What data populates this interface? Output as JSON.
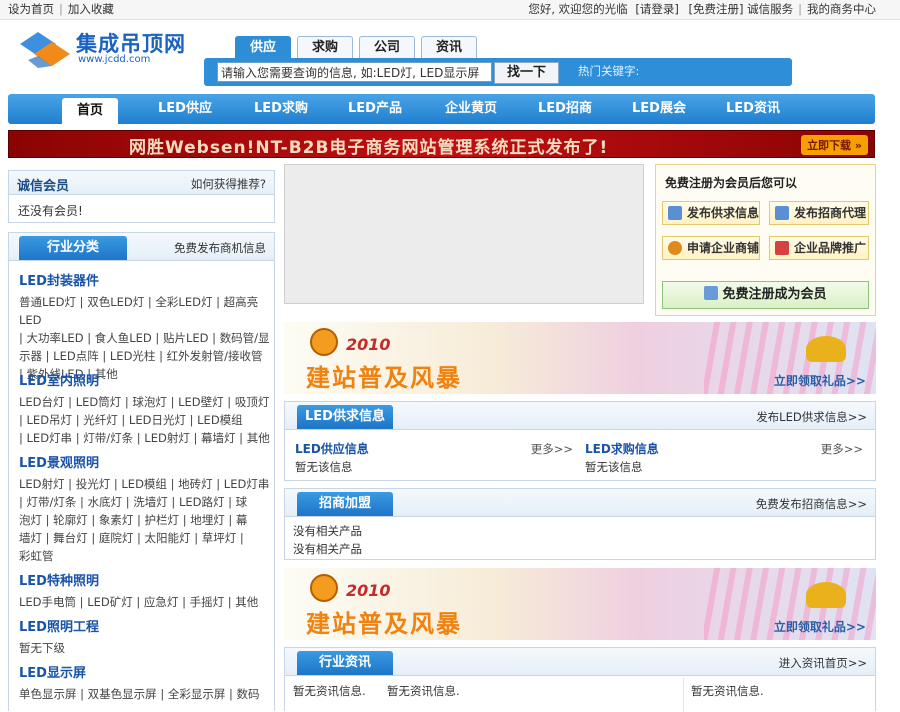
{
  "topbar": {
    "left": [
      "设为首页",
      "加入收藏"
    ],
    "welcome": "您好, 欢迎您的光临",
    "login": "[请登录]",
    "register": "[免费注册]",
    "service": "诚信服务",
    "center": "我的商务中心"
  },
  "logo": {
    "name": "集成吊顶网",
    "url": "www.jcdd.com"
  },
  "search": {
    "tabs": [
      "供应",
      "求购",
      "公司",
      "资讯"
    ],
    "placeholder": "请输入您需要查询的信息, 如:LED灯, LED显示屏",
    "button": "找一下",
    "hot_label": "热门关键字:"
  },
  "nav": [
    "首页",
    "LED供应",
    "LED求购",
    "LED产品",
    "企业黄页",
    "LED招商",
    "LED展会",
    "LED资讯"
  ],
  "banner": {
    "text": "网胜Websen!NT-B2B电子商务网站管理系统正式发布了!",
    "download": "立即下载 »"
  },
  "members": {
    "title": "诚信会员",
    "link": "如何获得推荐?",
    "empty": "还没有会员!"
  },
  "industry": {
    "tab": "行业分类",
    "link": "免费发布商机信息",
    "groups": [
      {
        "title": "LED封装器件",
        "lines": [
          "普通LED灯 | 双色LED灯 | 全彩LED灯 | 超高亮LED",
          "| 大功率LED | 食人鱼LED | 贴片LED | 数码管/显",
          "示器 | LED点阵 | LED光柱 | 红外发射管/接收管",
          "| 紫外线LED | 其他"
        ]
      },
      {
        "title": "LED室内照明",
        "lines": [
          "LED台灯 | LED筒灯 | 球泡灯 | LED壁灯 | 吸顶灯",
          "| LED吊灯 | 光纤灯 | LED日光灯 | LED模组",
          "| LED灯串 | 灯带/灯条 | LED射灯 | 幕墙灯 | 其他"
        ]
      },
      {
        "title": "LED景观照明",
        "lines": [
          "LED射灯 | 投光灯 | LED模组 | 地砖灯 | LED灯串",
          "| 灯带/灯条 | 水底灯 | 洗墙灯 | LED路灯 | 球",
          "泡灯 | 轮廓灯 | 象素灯 | 护栏灯 | 地埋灯 | 幕",
          "墙灯 | 舞台灯 | 庭院灯 | 太阳能灯 | 草坪灯 |",
          "彩虹管"
        ]
      },
      {
        "title": "LED特种照明",
        "lines": [
          "LED手电筒 | LED矿灯 | 应急灯 | 手摇灯 | 其他"
        ]
      },
      {
        "title": "LED照明工程",
        "lines": [
          "暂无下级"
        ]
      },
      {
        "title": "LED显示屏",
        "lines": [
          "单色显示屏 | 双基色显示屏 | 全彩显示屏 | 数码"
        ]
      }
    ]
  },
  "register_panel": {
    "title": "免费注册为会员后您可以",
    "buttons": [
      "发布供求信息",
      "发布招商代理",
      "申请企业商铺",
      "企业品牌推广"
    ],
    "main_button": "免费注册成为会员"
  },
  "ads": {
    "year": "2010",
    "slogan": "建站普及风暴",
    "gift": "立即领取礼品>>"
  },
  "supply_section": {
    "tab": "LED供求信息",
    "link": "发布LED供求信息>>",
    "cols": [
      {
        "title": "LED供应信息",
        "more": "更多>>",
        "empty": "暂无该信息"
      },
      {
        "title": "LED求购信息",
        "more": "更多>>",
        "empty": "暂无该信息"
      }
    ]
  },
  "invest_section": {
    "tab": "招商加盟",
    "link": "免费发布招商信息>>",
    "items": [
      "没有相关产品",
      "没有相关产品"
    ]
  },
  "news_section": {
    "tab": "行业资讯",
    "link": "进入资讯首页>>",
    "items": [
      "暂无资讯信息.",
      "暂无资讯信息.",
      "暂无资讯信息."
    ]
  },
  "colors": {
    "brand_blue": "#1f7fcf",
    "link_blue": "#1a54a8",
    "banner_red": "#c10f12"
  }
}
